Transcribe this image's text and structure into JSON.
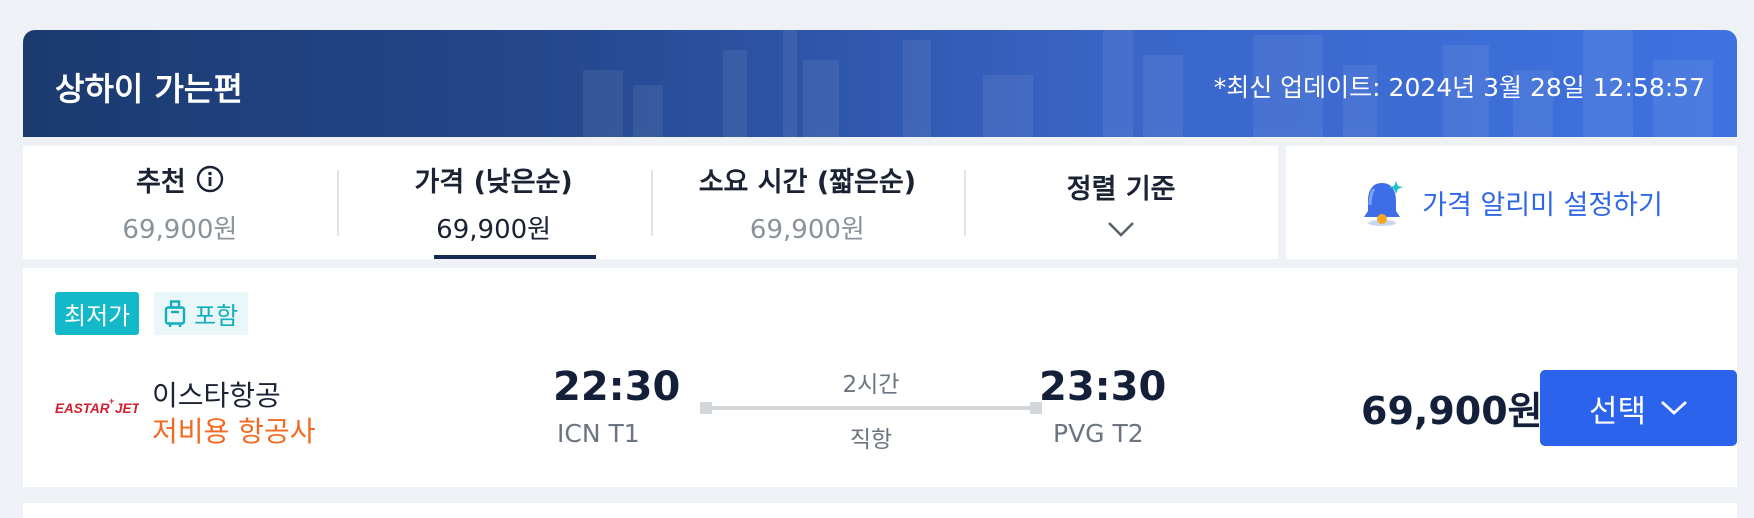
{
  "header": {
    "title": "상하이 가는편",
    "updated": "*최신 업데이트: 2024년 3월 28일 12:58:57"
  },
  "sort": {
    "tabs": [
      {
        "label": "추천",
        "price": "69,900원",
        "icon": "info-icon"
      },
      {
        "label": "가격 (낮은순)",
        "price": "69,900원",
        "active": true
      },
      {
        "label": "소요 시간 (짧은순)",
        "price": "69,900원"
      }
    ],
    "criteria_label": "정렬 기준"
  },
  "alert": {
    "label": "가격 알리미 설정하기",
    "icon": "bell-icon"
  },
  "flight": {
    "badges": {
      "lowest": "최저가",
      "baggage": "포함"
    },
    "airline": {
      "logo_text": "EASTAR JET",
      "name": "이스타항공",
      "type": "저비용 항공사"
    },
    "departure": {
      "time": "22:30",
      "airport": "ICN T1"
    },
    "arrival": {
      "time": "23:30",
      "airport": "PVG T2"
    },
    "duration": "2시간",
    "stops": "직항",
    "price": "69,900원",
    "select_label": "선택"
  },
  "colors": {
    "accent": "#2b63ec",
    "badge_teal": "#13b9c8",
    "lcc_orange": "#f26a21",
    "logo_red": "#d4202e"
  }
}
